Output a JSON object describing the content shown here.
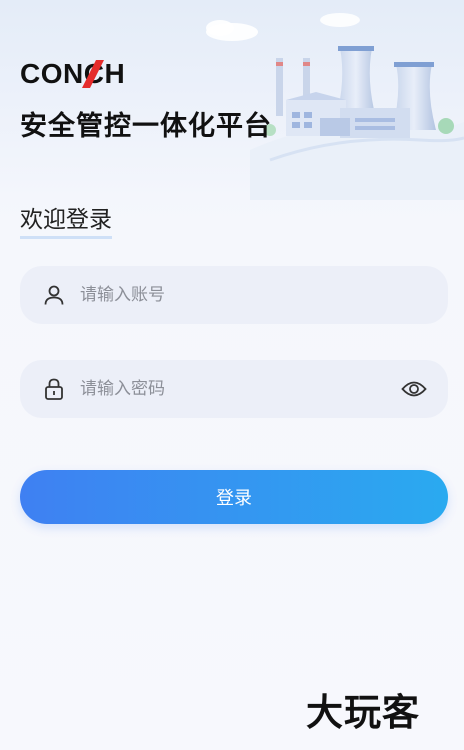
{
  "brand": {
    "logo_text": "CONCH",
    "app_title": "安全管控一体化平台"
  },
  "login": {
    "welcome": "欢迎登录",
    "account_placeholder": "请输入账号",
    "account_value": "",
    "password_placeholder": "请输入密码",
    "password_value": "",
    "submit_label": "登录"
  },
  "watermark": {
    "text": "大玩客"
  },
  "colors": {
    "accent_start": "#3f80f2",
    "accent_end": "#2aaaf0",
    "logo_accent": "#e52b2b",
    "field_bg": "#eceff8"
  },
  "icons": {
    "account": "user-icon",
    "password": "lock-icon",
    "toggle": "eye-icon"
  }
}
